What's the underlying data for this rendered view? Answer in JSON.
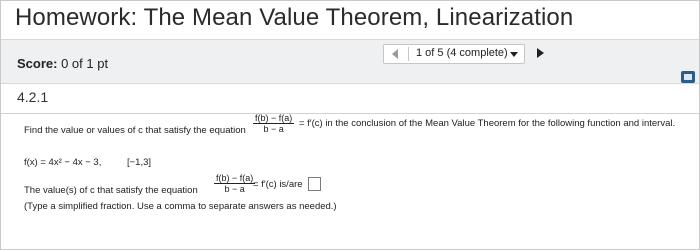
{
  "header": {
    "title": "Homework: The Mean Value Theorem, Linearization"
  },
  "score": {
    "label": "Score:",
    "value": "0 of 1 pt"
  },
  "nav": {
    "position": "1 of 5 (4 complete)"
  },
  "question": {
    "number": "4.2.1",
    "prompt_before": "Find the value or values of c that satisfy the equation",
    "frac_num": "f(b) − f(a)",
    "frac_den": "b − a",
    "prompt_after": "= f′(c) in the conclusion of the Mean Value Theorem for the following function and interval.",
    "function": "f(x) = 4x² − 4x − 3,",
    "interval": "[−1,3]",
    "answer_before": "The value(s) of c that satisfy the equation",
    "answer_after": "= f′(c) is/are",
    "hint": "(Type a simplified fraction. Use a comma to separate answers as needed.)"
  },
  "colors": {
    "score_bar_bg": "#eef0f2",
    "help_button": "#2b5c8a"
  },
  "icons": {
    "prev": "triangle-left-icon",
    "caret": "caret-down-icon",
    "next": "triangle-right-icon",
    "help": "keyboard-help-icon"
  }
}
